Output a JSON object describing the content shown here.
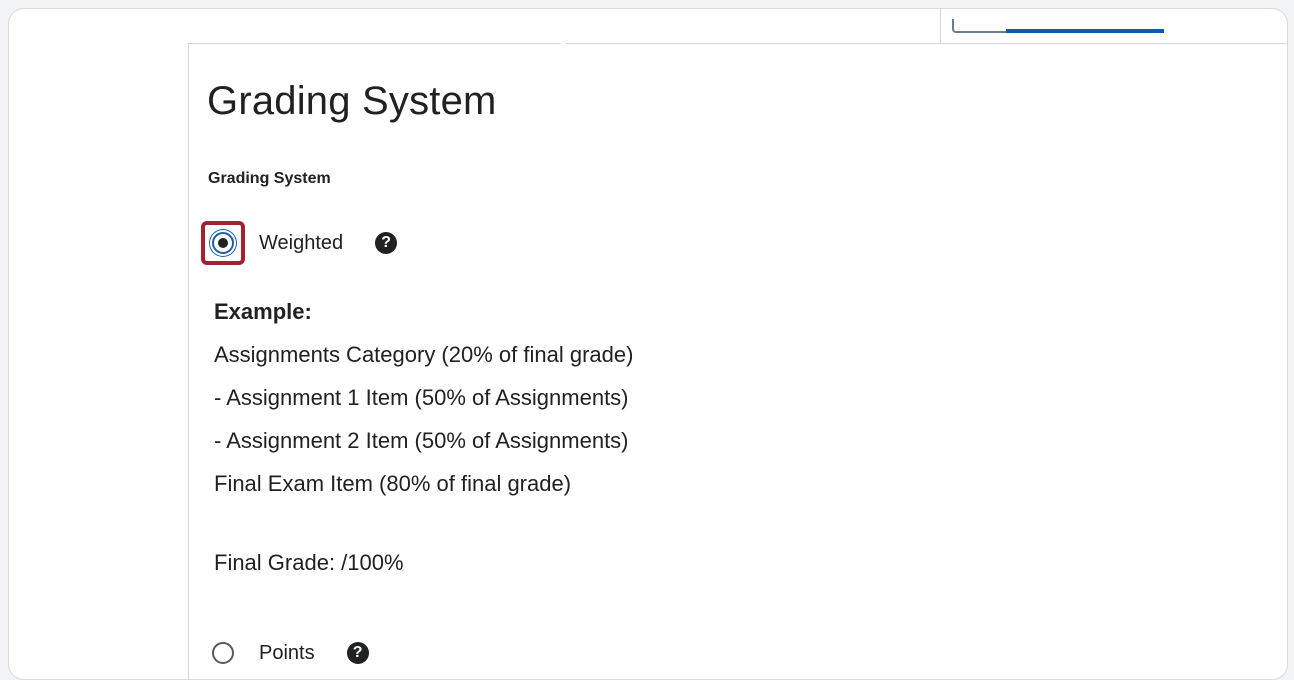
{
  "page": {
    "title": "Grading System",
    "section_label": "Grading System"
  },
  "options": {
    "weighted": {
      "label": "Weighted",
      "selected": true,
      "help_icon": "question-circle-icon"
    },
    "points": {
      "label": "Points",
      "selected": false,
      "help_icon": "question-circle-icon"
    }
  },
  "example": {
    "title": "Example:",
    "lines": [
      "Assignments Category (20% of final grade)",
      "- Assignment 1 Item (50% of Assignments)",
      "- Assignment 2 Item (50% of Assignments)",
      "Final Exam Item (80% of final grade)"
    ],
    "final_grade": "Final Grade: /100%"
  },
  "colors": {
    "highlight": "#a3222f",
    "radio_selected": "#1f5ea8",
    "accent_tab": "#0b5cad"
  }
}
